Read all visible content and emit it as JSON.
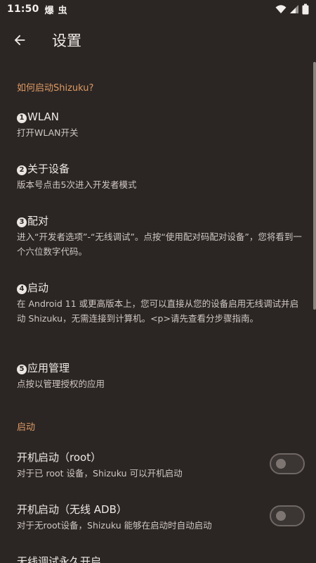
{
  "status_bar": {
    "time": "11:50",
    "app_icon_1": "爆",
    "app_icon_2": "虫"
  },
  "toolbar": {
    "title": "设置"
  },
  "sections": {
    "start_guide": {
      "header": "如何启动Shizuku?",
      "items": [
        {
          "num": "1",
          "title": "WLAN",
          "summary": "打开WLAN开关"
        },
        {
          "num": "2",
          "title": "关于设备",
          "summary": "版本号点击5次进入开发者模式"
        },
        {
          "num": "3",
          "title": "配对",
          "summary": "进入“开发者选项”-“无线调试”。点按“使用配对码配对设备”，您将看到一个六位数字代码。"
        },
        {
          "num": "4",
          "title": "启动",
          "summary": "在 Android 11 或更高版本上，您可以直接从您的设备启用无线调试并启动 Shizuku，无需连接到计算机。<p>请先查看分步骤指南。"
        },
        {
          "num": "5",
          "title": "应用管理",
          "summary": "点按以管理授权的应用"
        }
      ]
    },
    "startup": {
      "header": "启动",
      "items": [
        {
          "title": "开机启动（root）",
          "summary": "对于已 root 设备，Shizuku 可以开机启动",
          "checked": false
        },
        {
          "title": "开机启动（无线 ADB）",
          "summary": "对于无root设备，Shizuku 能够在启动时自动启动",
          "checked": false
        },
        {
          "title": "无线调试永久开启"
        }
      ]
    }
  },
  "colors": {
    "background": "#2b2624",
    "accent": "#e09a63"
  }
}
